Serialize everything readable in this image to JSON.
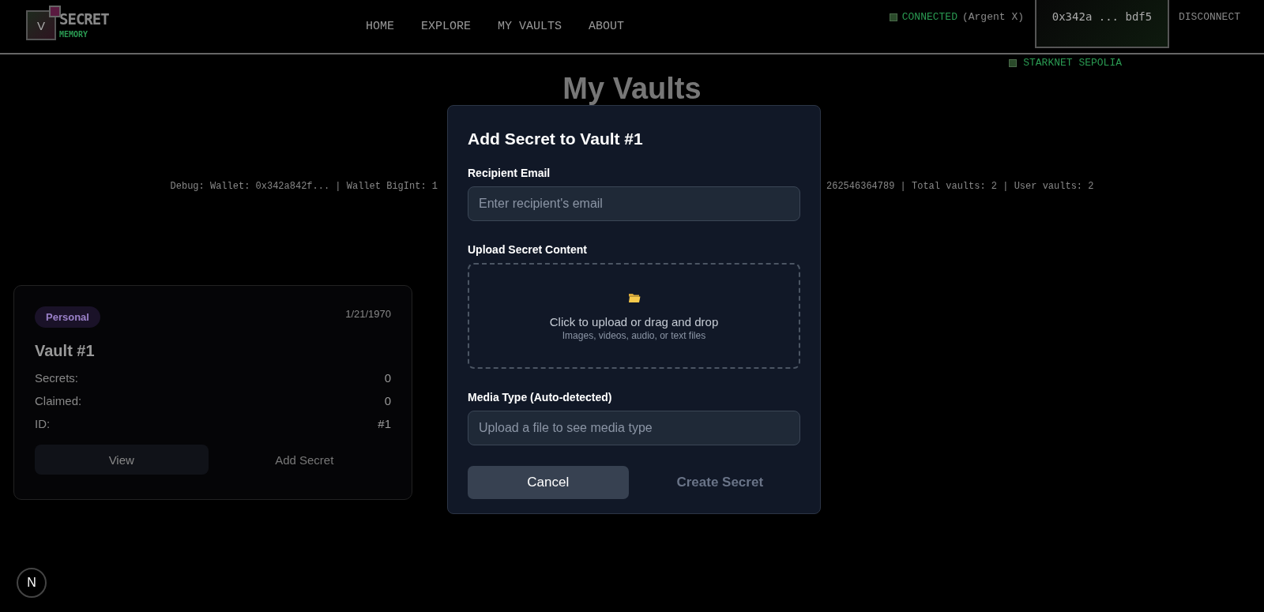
{
  "header": {
    "logo": {
      "letter": "V",
      "title": "SECRET",
      "subtitle": "MEMORY"
    },
    "nav": [
      "HOME",
      "EXPLORE",
      "MY VAULTS",
      "ABOUT"
    ],
    "wallet": {
      "status": "CONNECTED",
      "provider": "(Argent X)",
      "address": "0x342a ... bdf5",
      "disconnect": "DISCONNECT",
      "network": "STARKNET SEPOLIA"
    }
  },
  "page": {
    "title": "My Vaults",
    "debug_left": "Debug: Wallet: 0x342a842f... | Wallet BigInt: 1",
    "debug_right": "262546364789 | Total vaults: 2 | User vaults: 2"
  },
  "vaults": [
    {
      "tag": "Personal",
      "date": "1/21/1970",
      "name": "Vault #1",
      "stats": [
        {
          "label": "Secrets:",
          "value": "0"
        },
        {
          "label": "Claimed:",
          "value": "0"
        },
        {
          "label": "ID:",
          "value": "#1"
        }
      ],
      "buttons": [
        {
          "label": "View",
          "kind": "filled"
        },
        {
          "label": "Add Secret",
          "kind": "plain"
        }
      ]
    }
  ],
  "modal": {
    "title": "Add Secret to Vault #1",
    "fields": [
      {
        "kind": "input",
        "label": "Recipient Email",
        "placeholder": "Enter recipient's email"
      },
      {
        "kind": "dropzone",
        "label": "Upload Secret Content",
        "text": "Click to upload or drag and drop",
        "hint": "Images, videos, audio, or text files"
      },
      {
        "kind": "input",
        "label": "Media Type (Auto-detected)",
        "placeholder": "Upload a file to see media type"
      }
    ],
    "buttons": [
      {
        "label": "Cancel",
        "disabled": false
      },
      {
        "label": "Create Secret",
        "disabled": true
      }
    ]
  },
  "dev_badge": {
    "letter": "N"
  }
}
